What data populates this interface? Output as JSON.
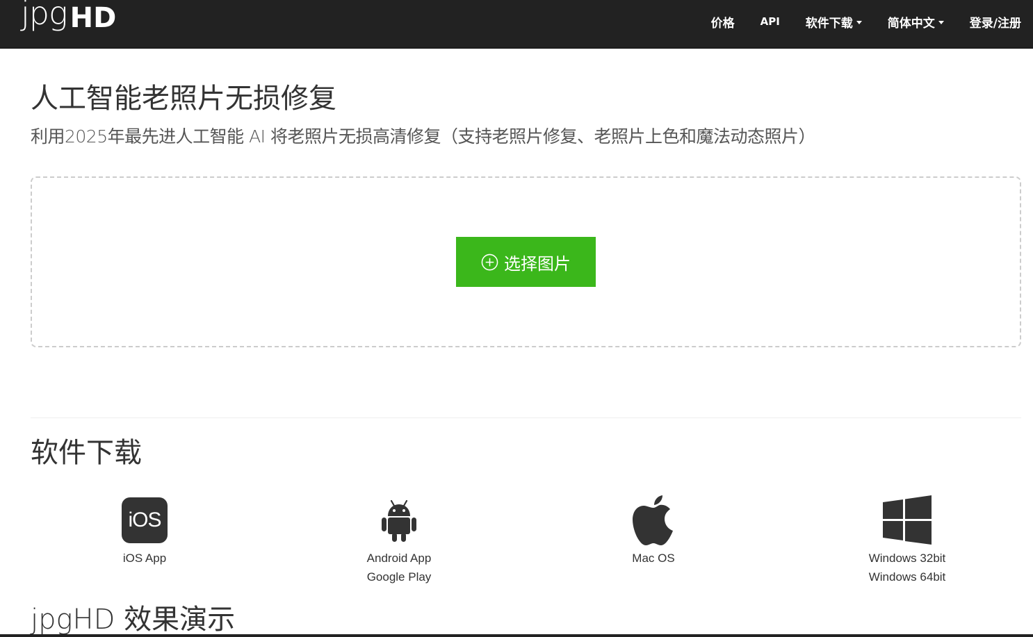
{
  "navbar": {
    "brand_light": "jpg",
    "brand_bold": "HD",
    "items": {
      "price": "价格",
      "api": "API",
      "download": "软件下载",
      "language": "简体中文",
      "login": "登录/注册"
    }
  },
  "hero": {
    "title": "人工智能老照片无损修复",
    "subtitle": "利用2025年最先进人工智能 AI 将老照片无损高清修复（支持老照片修复、老照片上色和魔法动态照片）",
    "upload_button": "选择图片"
  },
  "downloads": {
    "title": "软件下载",
    "ios": {
      "badge": "iOS",
      "label": "iOS App"
    },
    "android": {
      "label1": "Android App",
      "label2": "Google Play"
    },
    "mac": {
      "label": "Mac OS"
    },
    "windows": {
      "label1": "Windows 32bit",
      "label2": "Windows 64bit"
    }
  },
  "demo": {
    "title": "jpgHD 效果演示"
  },
  "colors": {
    "navbar_bg": "#222222",
    "button_green": "#3bb71b",
    "text": "#333333"
  },
  "icons": [
    "plus-circle-icon",
    "ios-icon",
    "android-icon",
    "apple-icon",
    "windows-icon",
    "caret-down-icon"
  ]
}
